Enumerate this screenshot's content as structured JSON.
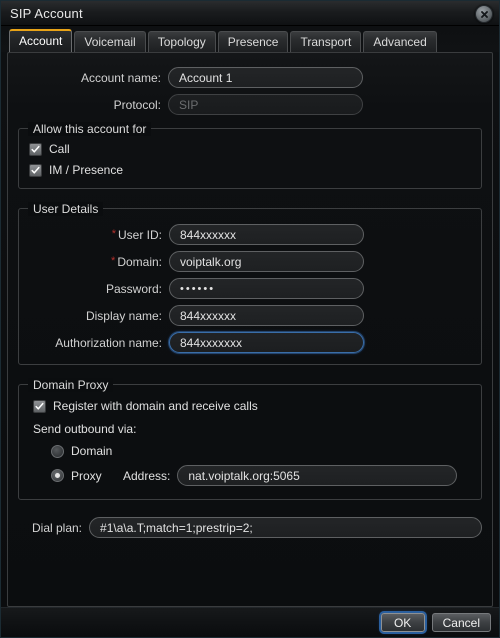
{
  "window": {
    "title": "SIP Account",
    "close_icon": "close-circle-icon"
  },
  "tabs": [
    {
      "label": "Account",
      "active": true
    },
    {
      "label": "Voicemail",
      "active": false
    },
    {
      "label": "Topology",
      "active": false
    },
    {
      "label": "Presence",
      "active": false
    },
    {
      "label": "Transport",
      "active": false
    },
    {
      "label": "Advanced",
      "active": false
    }
  ],
  "account": {
    "name_label": "Account name:",
    "name_value": "Account 1",
    "protocol_label": "Protocol:",
    "protocol_value": "SIP"
  },
  "allow": {
    "legend": "Allow this account for",
    "items": [
      {
        "label": "Call",
        "checked": true
      },
      {
        "label": "IM / Presence",
        "checked": true
      }
    ]
  },
  "user_details": {
    "legend": "User Details",
    "required_marker": "*",
    "fields": [
      {
        "label": "User ID:",
        "value": "844xxxxxx",
        "required": true,
        "type": "text",
        "focused": false
      },
      {
        "label": "Domain:",
        "value": "voiptalk.org",
        "required": true,
        "type": "text",
        "focused": false
      },
      {
        "label": "Password:",
        "value": "••••••",
        "required": false,
        "type": "password",
        "focused": false
      },
      {
        "label": "Display name:",
        "value": "844xxxxxx",
        "required": false,
        "type": "text",
        "focused": false
      },
      {
        "label": "Authorization name:",
        "value": "844xxxxxxx",
        "required": false,
        "type": "text",
        "focused": true
      }
    ]
  },
  "domain_proxy": {
    "legend": "Domain Proxy",
    "register_label": "Register with domain and receive calls",
    "register_checked": true,
    "send_outbound_label": "Send outbound via:",
    "options": [
      {
        "label": "Domain",
        "selected": false
      },
      {
        "label": "Proxy",
        "selected": true
      }
    ],
    "address_label": "Address:",
    "address_value": "nat.voiptalk.org:5065"
  },
  "dial_plan": {
    "label": "Dial plan:",
    "value": "#1\\a\\a.T;match=1;prestrip=2;"
  },
  "footer": {
    "ok_label": "OK",
    "cancel_label": "Cancel"
  },
  "colors": {
    "accent_tab": "#e8a317",
    "focus_blue": "#2a5f9e",
    "required_red": "#b4302c"
  }
}
